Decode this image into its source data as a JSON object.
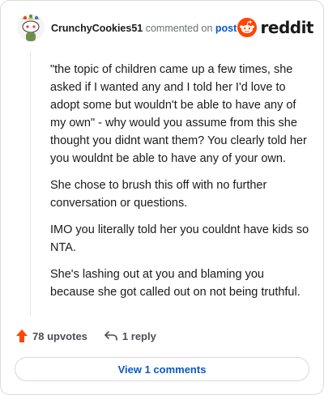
{
  "header": {
    "username": "CrunchyCookies51",
    "commented_on": "commented on",
    "post_link": "post",
    "brand": "reddit"
  },
  "comment": {
    "paragraphs": [
      "\"the topic of children came up a few times, she asked if I wanted any and I told her I'd love to adopt some but wouldn't be able to have any of my own\" - why would you assume from this she thought you didnt want them? You clearly told her you wouldnt be able to have any of your own.",
      "She chose to brush this off with no further conversation or questions.",
      "IMO you literally told her you couldnt have kids so NTA.",
      "She's lashing out at you and blaming you because she got called out on not being truthful."
    ]
  },
  "actions": {
    "upvotes": "78 upvotes",
    "replies": "1 reply"
  },
  "view_comments": "View 1 comments",
  "colors": {
    "upvote_arrow": "#ff4500",
    "reddit_orange": "#ff4500",
    "link_blue": "#0a58ca"
  }
}
